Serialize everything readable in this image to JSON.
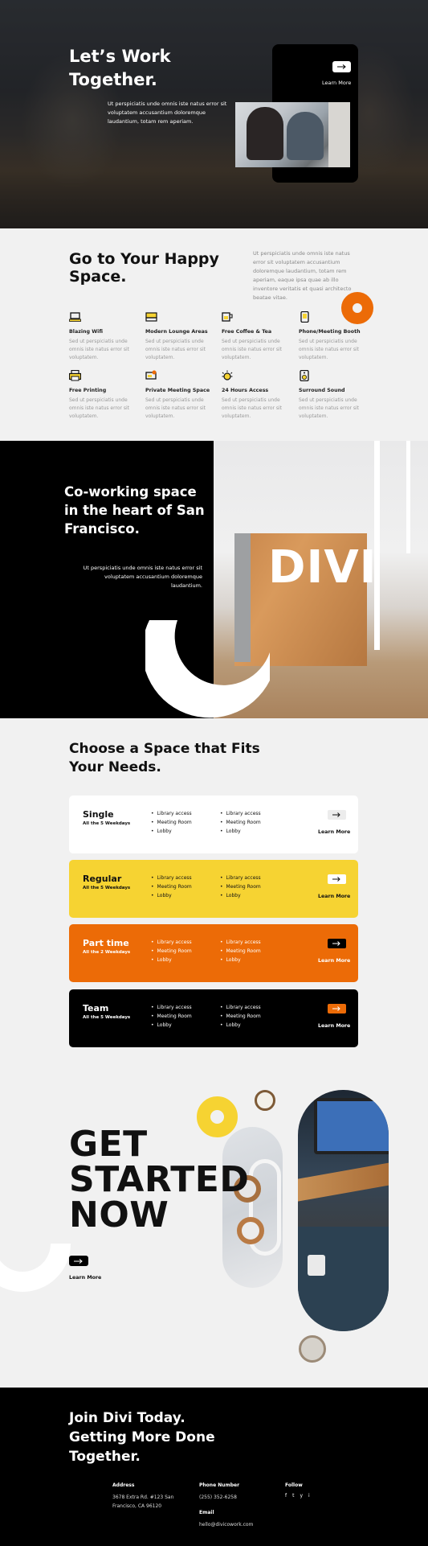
{
  "hero": {
    "title": "Let’s Work Together.",
    "text": "Ut perspiciatis unde omnis iste natus error sit voluptatem accusantium doloremque laudantium, totam rem aperiam.",
    "card_link": "Learn More"
  },
  "happy": {
    "title": "Go to Your Happy Space.",
    "text": "Ut perspiciatis unde omnis iste natus error sit voluptatem accusantium doloremque laudantium, totam rem aperiam, eaque ipsa quae ab illo inventore veritatis et quasi architecto beatae vitae.",
    "features": [
      {
        "title": "Blazing Wifi",
        "desc": "Sed ut perspiciatis unde omnis iste natus error sit voluptatem.",
        "icon": "laptop-icon"
      },
      {
        "title": "Modern Lounge Areas",
        "desc": "Sed ut perspiciatis unde omnis iste natus error sit voluptatem.",
        "icon": "sofa-icon"
      },
      {
        "title": "Free Coffee & Tea",
        "desc": "Sed ut perspiciatis unde omnis iste natus error sit voluptatem.",
        "icon": "coffee-icon"
      },
      {
        "title": "Phone/Meeting Booth",
        "desc": "Sed ut perspiciatis unde omnis iste natus error sit voluptatem.",
        "icon": "phone-icon"
      },
      {
        "title": "Free Printing",
        "desc": "Sed ut perspiciatis unde omnis iste natus error sit voluptatem.",
        "icon": "printer-icon"
      },
      {
        "title": "Private Meeting Space",
        "desc": "Sed ut perspiciatis unde omnis iste natus error sit voluptatem.",
        "icon": "meeting-icon"
      },
      {
        "title": "24 Hours Access",
        "desc": "Sed ut perspiciatis unde omnis iste natus error sit voluptatem.",
        "icon": "sun-clock-icon"
      },
      {
        "title": "Surround Sound",
        "desc": "Sed ut perspiciatis unde omnis iste natus error sit voluptatem.",
        "icon": "speaker-icon"
      }
    ]
  },
  "cowork": {
    "title": "Co-working space in the heart of San Francisco.",
    "text": "Ut perspiciatis unde omnis iste natus error sit voluptatem accusantium doloremque laudantium.",
    "brand": "DIVI"
  },
  "spaces": {
    "title": "Choose a Space that Fits Your Needs.",
    "plans": [
      {
        "name": "Single",
        "sub": "All the 5 Weekdays",
        "col1": [
          "Library access",
          "Meeting Room",
          "Lobby"
        ],
        "col2": [
          "Library access",
          "Meeting Room",
          "Lobby"
        ],
        "link": "Learn More",
        "bg": "#ffffff",
        "fg": "#111111",
        "btn_bg": "#ececec",
        "btn_fg": "#111111"
      },
      {
        "name": "Regular",
        "sub": "All the 5 Weekdays",
        "col1": [
          "Library access",
          "Meeting Room",
          "Lobby"
        ],
        "col2": [
          "Library access",
          "Meeting Room",
          "Lobby"
        ],
        "link": "Learn More",
        "bg": "#f6d332",
        "fg": "#111111",
        "btn_bg": "#ffffff",
        "btn_fg": "#111111"
      },
      {
        "name": "Part time",
        "sub": "All the 2 Weekdays",
        "col1": [
          "Library access",
          "Meeting Room",
          "Lobby"
        ],
        "col2": [
          "Library access",
          "Meeting Room",
          "Lobby"
        ],
        "link": "Learn More",
        "bg": "#ec6b07",
        "fg": "#ffffff",
        "btn_bg": "#000000",
        "btn_fg": "#ffffff"
      },
      {
        "name": "Team",
        "sub": "All the 5 Weekdays",
        "col1": [
          "Library access",
          "Meeting Room",
          "Lobby"
        ],
        "col2": [
          "Library access",
          "Meeting Room",
          "Lobby"
        ],
        "link": "Learn More",
        "bg": "#000000",
        "fg": "#ffffff",
        "btn_bg": "#ec6b07",
        "btn_fg": "#ffffff"
      }
    ]
  },
  "start": {
    "title_lines": [
      "GET",
      "STARTED",
      "NOW"
    ],
    "link": "Learn More"
  },
  "footer": {
    "title": "Join Divi Today. Getting More Done Together.",
    "address_label": "Address",
    "address": "3678 Extra Rd. #123 San Francisco, CA 96120",
    "phone_label": "Phone Number",
    "phone": "(255) 352-6258",
    "email_label": "Email",
    "email": "hello@divicowork.com",
    "follow_label": "Follow",
    "social": [
      "f",
      "t",
      "y",
      "i"
    ]
  },
  "colors": {
    "orange": "#ec6b07",
    "yellow": "#f6d332",
    "black": "#000000",
    "light_bg": "#f1f1f1"
  }
}
